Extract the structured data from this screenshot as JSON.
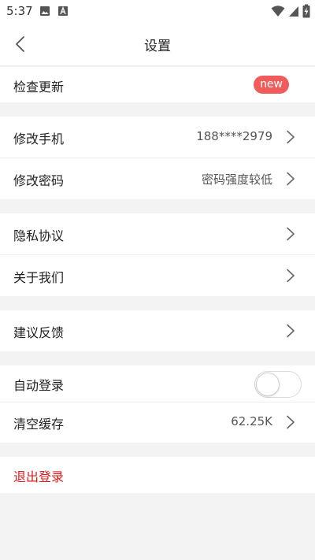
{
  "status_bar": {
    "time": "5:37",
    "left_icons": [
      "image-icon",
      "a-icon"
    ],
    "right_icons": [
      "wifi-icon",
      "cellular-signal-icon",
      "battery-charging-icon"
    ]
  },
  "header": {
    "title": "设置",
    "back_icon": "chevron-left-icon"
  },
  "groups": [
    {
      "items": [
        {
          "label": "检查更新",
          "badge": "new"
        }
      ]
    },
    {
      "items": [
        {
          "label": "修改手机",
          "value": "188****2979"
        },
        {
          "label": "修改密码",
          "value": "密码强度较低"
        }
      ]
    },
    {
      "items": [
        {
          "label": "隐私协议"
        },
        {
          "label": "关于我们"
        }
      ]
    },
    {
      "items": [
        {
          "label": "建议反馈"
        }
      ]
    },
    {
      "items": [
        {
          "label": "自动登录",
          "toggle": false
        },
        {
          "label": "清空缓存",
          "value": "62.25K"
        }
      ]
    },
    {
      "items": [
        {
          "label": "退出登录"
        }
      ]
    }
  ],
  "colors": {
    "badge_bg": "#f05b5b",
    "logout_text": "#e01b1b",
    "page_bg": "#f3f3f3"
  }
}
